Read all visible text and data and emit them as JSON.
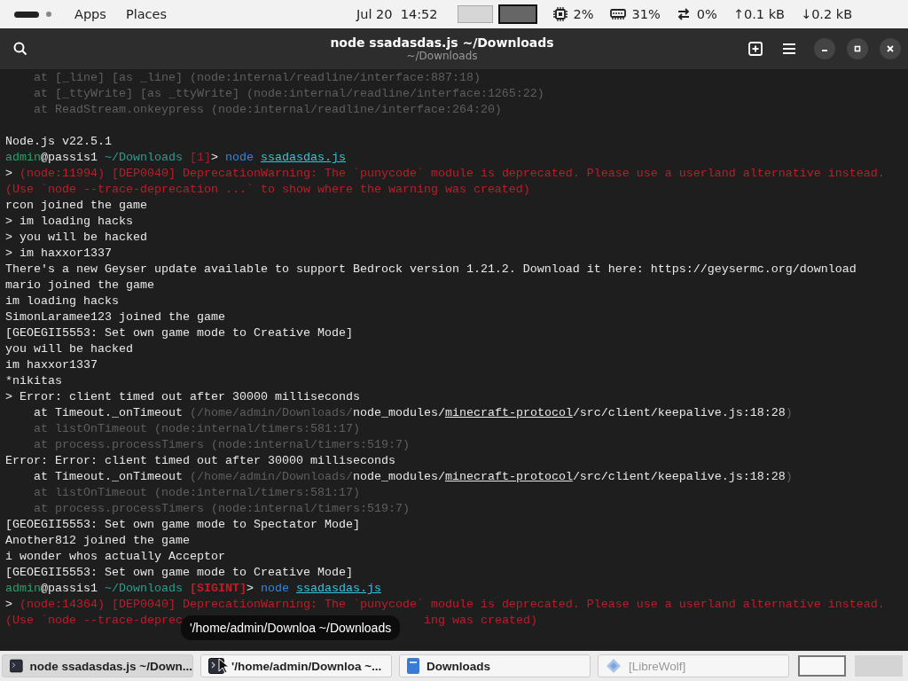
{
  "top_bar": {
    "menus": [
      "Apps",
      "Places"
    ],
    "clock": "Jul 20  14:52",
    "stats": [
      {
        "kind": "cpu",
        "text": "2%"
      },
      {
        "kind": "memory",
        "text": "31%"
      },
      {
        "kind": "swap",
        "text": "0%"
      },
      {
        "kind": "upload",
        "text": "↑0.1 kB"
      },
      {
        "kind": "download",
        "text": "↓0.2 kB"
      }
    ]
  },
  "window": {
    "title": "node ssadasdas.js ~/Downloads",
    "subtitle": "~/Downloads"
  },
  "terminal": {
    "lines": [
      {
        "kind": "text",
        "segments": [
          {
            "kind": "dim",
            "text": "    at [_line] [as _line] (node:internal/readline/interface:887:18)"
          }
        ]
      },
      {
        "kind": "text",
        "segments": [
          {
            "kind": "dim",
            "text": "    at [_ttyWrite] [as _ttyWrite] (node:internal/readline/interface:1265:22)"
          }
        ]
      },
      {
        "kind": "text",
        "segments": [
          {
            "kind": "dim",
            "text": "    at ReadStream.onkeypress (node:internal/readline/interface:264:20)"
          }
        ]
      },
      {
        "kind": "blank"
      },
      {
        "kind": "text",
        "segments": [
          {
            "kind": "plain",
            "text": "Node.js v22.5.1"
          }
        ]
      },
      {
        "kind": "text",
        "segments": [
          {
            "kind": "user",
            "text": "admin"
          },
          {
            "kind": "plain",
            "text": "@passis1 "
          },
          {
            "kind": "path",
            "text": "~/Downloads "
          },
          {
            "kind": "status",
            "text": "[1]"
          },
          {
            "kind": "plain",
            "text": "> "
          },
          {
            "kind": "command",
            "text": "node "
          },
          {
            "kind": "link",
            "text": "ssadasdas.js"
          }
        ]
      },
      {
        "kind": "text",
        "segments": [
          {
            "kind": "plain",
            "text": "> "
          },
          {
            "kind": "red",
            "text": "(node:11994) [DEP0040] DeprecationWarning: The `punycode` module is deprecated. Please use a userland alternative instead."
          }
        ]
      },
      {
        "kind": "text",
        "segments": [
          {
            "kind": "red",
            "text": "(Use `node --trace-deprecation ...` to show where the warning was created)"
          }
        ]
      },
      {
        "kind": "text",
        "segments": [
          {
            "kind": "plain",
            "text": "rcon joined the game"
          }
        ]
      },
      {
        "kind": "text",
        "segments": [
          {
            "kind": "plain",
            "text": "> im loading hacks"
          }
        ]
      },
      {
        "kind": "text",
        "segments": [
          {
            "kind": "plain",
            "text": "> you will be hacked"
          }
        ]
      },
      {
        "kind": "text",
        "segments": [
          {
            "kind": "plain",
            "text": "> im haxxor1337"
          }
        ]
      },
      {
        "kind": "text",
        "segments": [
          {
            "kind": "plain",
            "text": "There's a new Geyser update available to support Bedrock version 1.21.2. Download it here: https://geysermc.org/download"
          }
        ]
      },
      {
        "kind": "text",
        "segments": [
          {
            "kind": "plain",
            "text": "mario joined the game"
          }
        ]
      },
      {
        "kind": "text",
        "segments": [
          {
            "kind": "plain",
            "text": "im loading hacks"
          }
        ]
      },
      {
        "kind": "text",
        "segments": [
          {
            "kind": "plain",
            "text": "SimonLaramee123 joined the game"
          }
        ]
      },
      {
        "kind": "text",
        "segments": [
          {
            "kind": "plain",
            "text": "[GEOEGII5553: Set own game mode to Creative Mode]"
          }
        ]
      },
      {
        "kind": "text",
        "segments": [
          {
            "kind": "plain",
            "text": "you will be hacked"
          }
        ]
      },
      {
        "kind": "text",
        "segments": [
          {
            "kind": "plain",
            "text": "im haxxor1337"
          }
        ]
      },
      {
        "kind": "text",
        "segments": [
          {
            "kind": "plain",
            "text": "*nikitas"
          }
        ]
      },
      {
        "kind": "text",
        "segments": [
          {
            "kind": "plain",
            "text": "> Error: client timed out after 30000 milliseconds"
          }
        ]
      },
      {
        "kind": "text",
        "segments": [
          {
            "kind": "plain",
            "text": "    at Timeout._onTimeout "
          },
          {
            "kind": "dim",
            "text": "(/home/admin/Downloads/"
          },
          {
            "kind": "plain",
            "text": "node_modules/"
          },
          {
            "kind": "underline",
            "text": "minecraft-protocol"
          },
          {
            "kind": "plain",
            "text": "/src/client/keepalive.js:18:28"
          },
          {
            "kind": "dim",
            "text": ")"
          }
        ]
      },
      {
        "kind": "text",
        "segments": [
          {
            "kind": "dim",
            "text": "    at listOnTimeout (node:internal/timers:581:17)"
          }
        ]
      },
      {
        "kind": "text",
        "segments": [
          {
            "kind": "dim",
            "text": "    at process.processTimers (node:internal/timers:519:7)"
          }
        ]
      },
      {
        "kind": "text",
        "segments": [
          {
            "kind": "plain",
            "text": "Error: Error: client timed out after 30000 milliseconds"
          }
        ]
      },
      {
        "kind": "text",
        "segments": [
          {
            "kind": "plain",
            "text": "    at Timeout._onTimeout "
          },
          {
            "kind": "dim",
            "text": "(/home/admin/Downloads/"
          },
          {
            "kind": "plain",
            "text": "node_modules/"
          },
          {
            "kind": "underline",
            "text": "minecraft-protocol"
          },
          {
            "kind": "plain",
            "text": "/src/client/keepalive.js:18:28"
          },
          {
            "kind": "dim",
            "text": ")"
          }
        ]
      },
      {
        "kind": "text",
        "segments": [
          {
            "kind": "dim",
            "text": "    at listOnTimeout (node:internal/timers:581:17)"
          }
        ]
      },
      {
        "kind": "text",
        "segments": [
          {
            "kind": "dim",
            "text": "    at process.processTimers (node:internal/timers:519:7)"
          }
        ]
      },
      {
        "kind": "text",
        "segments": [
          {
            "kind": "plain",
            "text": "[GEOEGII5553: Set own game mode to Spectator Mode]"
          }
        ]
      },
      {
        "kind": "text",
        "segments": [
          {
            "kind": "plain",
            "text": "Another812 joined the game"
          }
        ]
      },
      {
        "kind": "text",
        "segments": [
          {
            "kind": "plain",
            "text": "i wonder whos actually Acceptor"
          }
        ]
      },
      {
        "kind": "text",
        "segments": [
          {
            "kind": "plain",
            "text": "[GEOEGII5553: Set own game mode to Creative Mode]"
          }
        ]
      },
      {
        "kind": "text",
        "segments": [
          {
            "kind": "user",
            "text": "admin"
          },
          {
            "kind": "plain",
            "text": "@passis1 "
          },
          {
            "kind": "path",
            "text": "~/Downloads "
          },
          {
            "kind": "status_bold",
            "text": "[SIGINT]"
          },
          {
            "kind": "plain",
            "text": "> "
          },
          {
            "kind": "command",
            "text": "node "
          },
          {
            "kind": "link",
            "text": "ssadasdas.js"
          }
        ]
      },
      {
        "kind": "text",
        "segments": [
          {
            "kind": "plain",
            "text": "> "
          },
          {
            "kind": "red",
            "text": "(node:14364) [DEP0040] DeprecationWarning: The `punycode` module is deprecated. Please use a userland alternative instead."
          }
        ]
      },
      {
        "kind": "text",
        "segments": [
          {
            "kind": "red",
            "text": "(Use `node --trace-deprec"
          },
          {
            "kind": "red_after_gap",
            "text": "ing was created)"
          }
        ]
      }
    ]
  },
  "tooltip": "'/home/admin/Downloa ~/Downloads",
  "taskbar": {
    "tasks": [
      {
        "kind": "terminal",
        "label": "node ssadasdas.js ~/Down...",
        "selected": true
      },
      {
        "kind": "terminal",
        "label": "'/home/admin/Downloa ~...",
        "selected": false
      },
      {
        "kind": "files",
        "label": "Downloads",
        "selected": false
      },
      {
        "kind": "browser",
        "label": "[LibreWolf]",
        "selected": false
      }
    ],
    "workspaces": [
      {
        "selected": true
      },
      {
        "selected": false
      }
    ]
  }
}
